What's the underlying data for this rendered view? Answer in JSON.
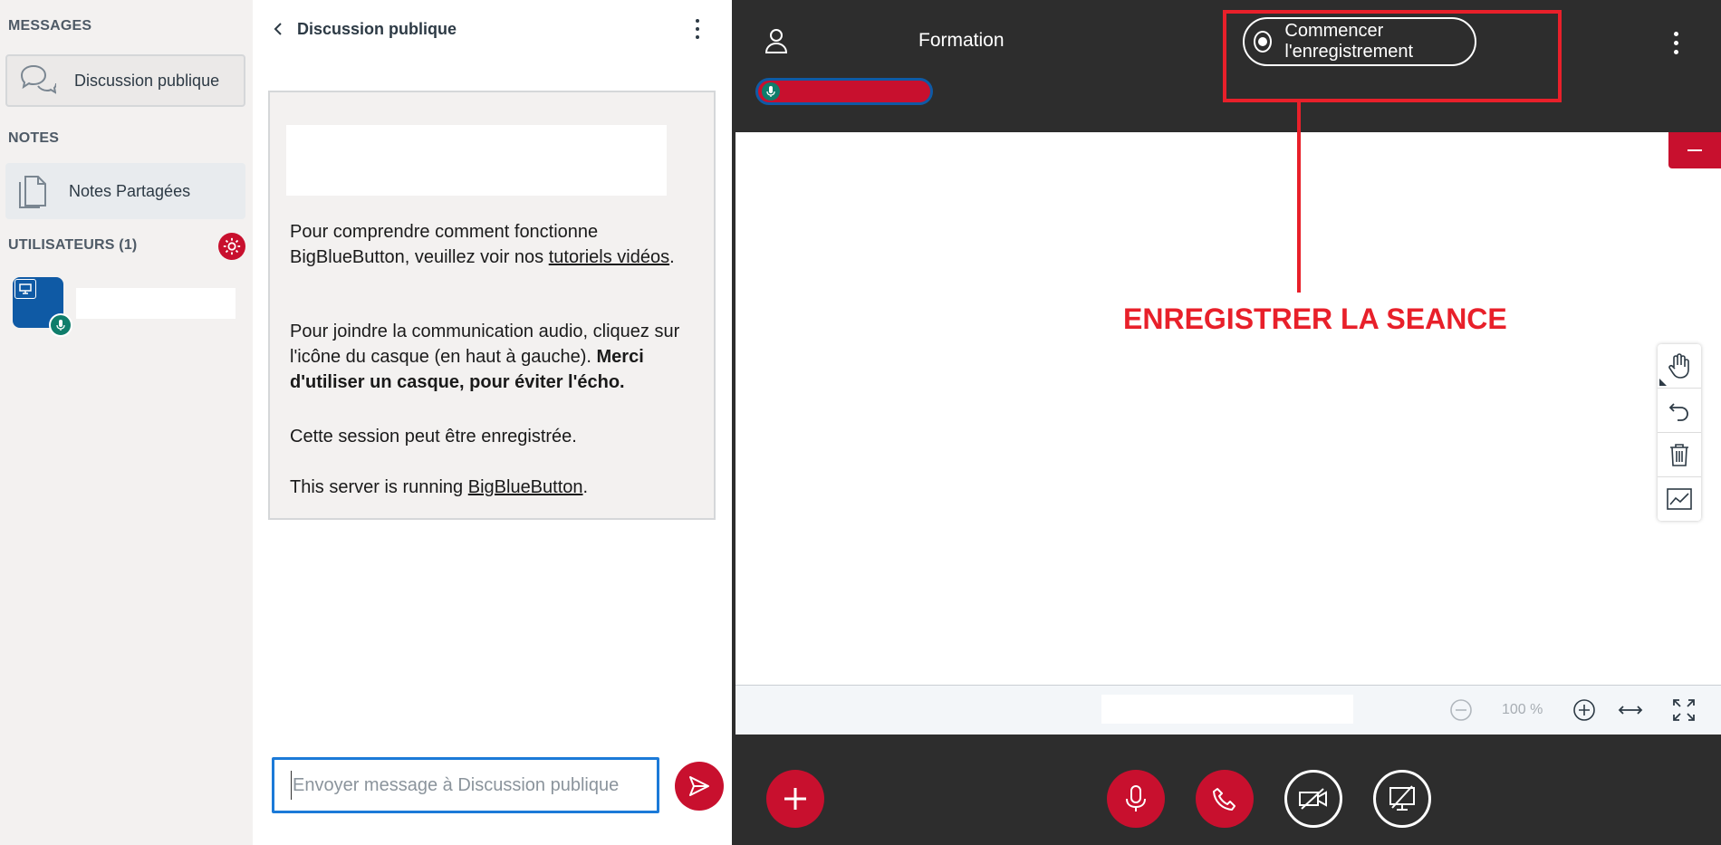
{
  "sidebar": {
    "messages_title": "MESSAGES",
    "public_chat_label": "Discussion publique",
    "notes_title": "NOTES",
    "shared_notes_label": "Notes Partagées",
    "users_title": "UTILISATEURS (1)"
  },
  "chat": {
    "header_title": "Discussion publique",
    "welcome_p1_a": "Pour comprendre comment fonctionne BigBlueButton, veuillez voir nos ",
    "welcome_p1_link": "tutoriels vidéos",
    "welcome_p1_end": ".",
    "welcome_p2_a": "Pour joindre la communication audio, cliquez sur l'icône du casque (en haut à gauche). ",
    "welcome_p2_bold": "Merci d'utiliser un casque, pour éviter l'écho.",
    "welcome_p3": "Cette session peut être enregistrée.",
    "welcome_p4_a": "This server is running ",
    "welcome_p4_link": "BigBlueButton",
    "welcome_p4_end": ".",
    "input_placeholder": "Envoyer message à Discussion publique"
  },
  "meeting": {
    "title": "Formation",
    "record_label": "Commencer l'enregistrement",
    "annotation": "ENREGISTRER LA SEANCE",
    "zoom_label": "100 %"
  },
  "colors": {
    "accent": "#c8102e",
    "annotation": "#e8202a",
    "dark": "#2d2d2d",
    "sidebar_bg": "#f3f1f0",
    "user_blue": "#0f5aa5",
    "mic_green": "#0f7d6b"
  },
  "icons": [
    "chat-bubbles-icon",
    "document-icon",
    "gear-icon",
    "presenter-icon",
    "microphone-icon",
    "chevron-left-icon",
    "kebab-menu-icon",
    "user-icon",
    "record-icon",
    "minimize-icon",
    "hand-icon",
    "undo-icon",
    "trash-icon",
    "chart-icon",
    "zoom-out-icon",
    "zoom-in-icon",
    "fit-width-icon",
    "fullscreen-icon",
    "plus-icon",
    "phone-icon",
    "camera-off-icon",
    "screenshare-off-icon",
    "send-icon"
  ]
}
